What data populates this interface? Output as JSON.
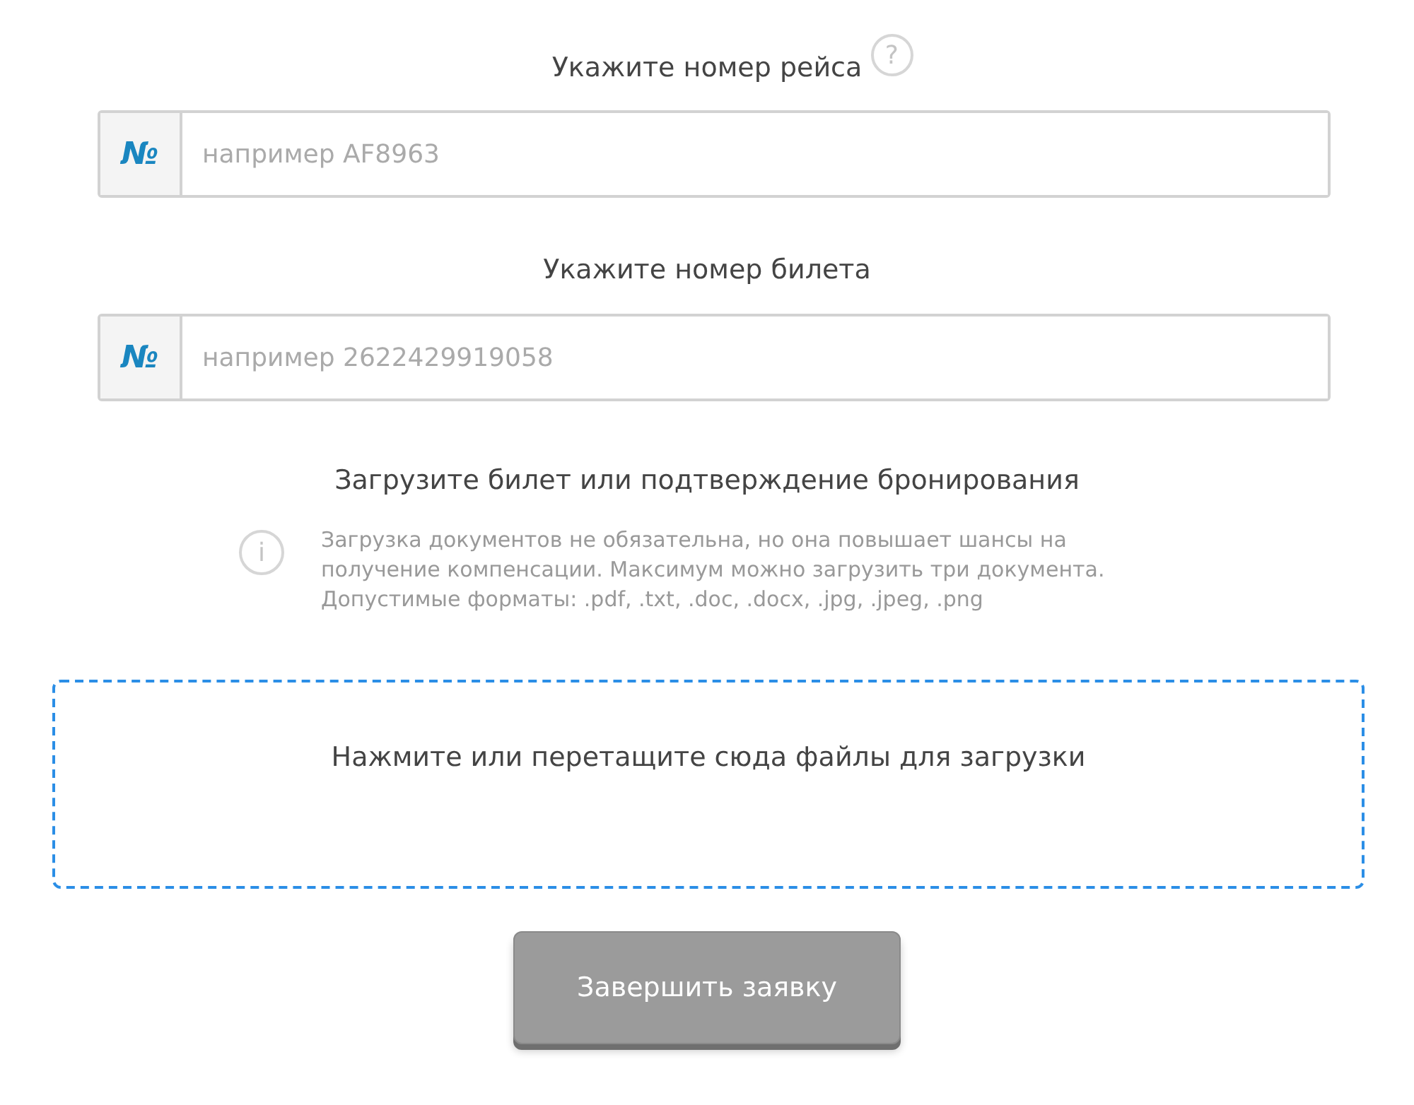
{
  "flight": {
    "label": "Укажите номер рейса",
    "help_icon": "?",
    "prefix": "№",
    "placeholder": "например AF8963"
  },
  "ticket": {
    "label": "Укажите номер билета",
    "prefix": "№",
    "placeholder": "например 2622429919058"
  },
  "upload": {
    "heading": "Загрузите билет или подтверждение бронирования",
    "info_icon": "i",
    "note": "Загрузка документов не обязательна, но она повышает шансы на получение компенсации. Максимум можно загрузить три документа. Допустимые форматы: .pdf, .txt, .doc, .docx, .jpg, .jpeg, .png",
    "dropzone": "Нажмите или перетащите сюда файлы для загрузки"
  },
  "submit": {
    "label": "Завершить заявку",
    "disabled": true
  }
}
